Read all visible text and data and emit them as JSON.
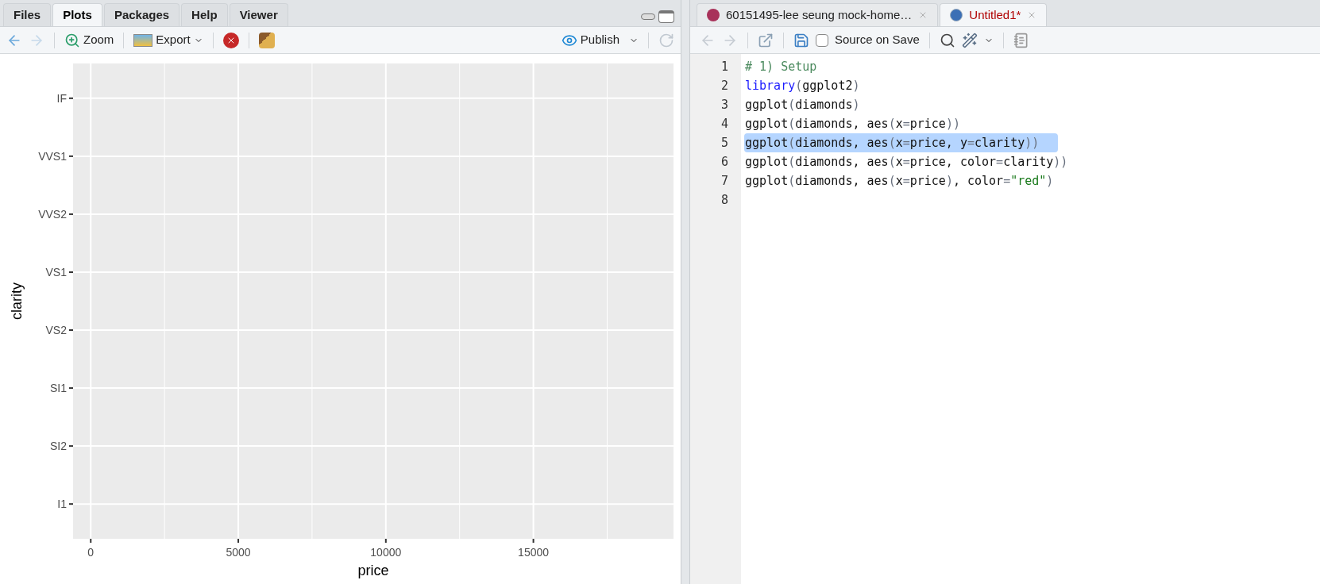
{
  "plots_pane": {
    "tabs": [
      {
        "label": "Files",
        "selected": false
      },
      {
        "label": "Plots",
        "selected": true
      },
      {
        "label": "Packages",
        "selected": false
      },
      {
        "label": "Help",
        "selected": false
      },
      {
        "label": "Viewer",
        "selected": false
      }
    ],
    "toolbar": {
      "zoom": "Zoom",
      "export": "Export",
      "publish": "Publish"
    },
    "chart_data": {
      "type": "scatter",
      "xlabel": "price",
      "ylabel": "clarity",
      "xlim": [
        -599,
        19748
      ],
      "xticks": [
        {
          "value": 0,
          "label": "0"
        },
        {
          "value": 5000,
          "label": "5000"
        },
        {
          "value": 10000,
          "label": "10000"
        },
        {
          "value": 15000,
          "label": "15000"
        }
      ],
      "orientation": "horizontal",
      "categories": [
        "IF",
        "VVS1",
        "VVS2",
        "VS1",
        "VS2",
        "SI1",
        "SI2",
        "I1"
      ],
      "grid": true
    }
  },
  "editor_pane": {
    "tabs": [
      {
        "label": "60151495-lee seung mock-home…",
        "kind": "rmd",
        "selected": false,
        "modified": false
      },
      {
        "label": "Untitled1*",
        "kind": "r",
        "selected": true,
        "modified": true
      }
    ],
    "toolbar": {
      "source_on_save": {
        "label": "Source on Save",
        "checked": false
      }
    },
    "lines": [
      {
        "number": "1",
        "selected": false,
        "tokens": [
          {
            "kind": "comment",
            "text": "# 1) Setup"
          }
        ]
      },
      {
        "number": "2",
        "selected": false,
        "tokens": [
          {
            "kind": "keyword",
            "text": "library"
          },
          {
            "kind": "paren",
            "text": "("
          },
          {
            "kind": "plain",
            "text": "ggplot2"
          },
          {
            "kind": "paren",
            "text": ")"
          }
        ]
      },
      {
        "number": "3",
        "selected": false,
        "tokens": [
          {
            "kind": "plain",
            "text": "ggplot"
          },
          {
            "kind": "paren",
            "text": "("
          },
          {
            "kind": "plain",
            "text": "diamonds"
          },
          {
            "kind": "paren",
            "text": ")"
          }
        ]
      },
      {
        "number": "4",
        "selected": false,
        "tokens": [
          {
            "kind": "plain",
            "text": "ggplot"
          },
          {
            "kind": "paren",
            "text": "("
          },
          {
            "kind": "plain",
            "text": "diamonds, aes"
          },
          {
            "kind": "paren",
            "text": "("
          },
          {
            "kind": "plain",
            "text": "x"
          },
          {
            "kind": "paren",
            "text": "="
          },
          {
            "kind": "plain",
            "text": "price"
          },
          {
            "kind": "paren",
            "text": "))"
          }
        ]
      },
      {
        "number": "5",
        "selected": true,
        "tokens": [
          {
            "kind": "plain",
            "text": "ggplot"
          },
          {
            "kind": "paren",
            "text": "("
          },
          {
            "kind": "plain",
            "text": "diamonds, aes"
          },
          {
            "kind": "paren",
            "text": "("
          },
          {
            "kind": "plain",
            "text": "x"
          },
          {
            "kind": "paren",
            "text": "="
          },
          {
            "kind": "plain",
            "text": "price, y"
          },
          {
            "kind": "paren",
            "text": "="
          },
          {
            "kind": "plain",
            "text": "clarity"
          },
          {
            "kind": "paren",
            "text": "))"
          }
        ]
      },
      {
        "number": "6",
        "selected": false,
        "tokens": [
          {
            "kind": "plain",
            "text": "ggplot"
          },
          {
            "kind": "paren",
            "text": "("
          },
          {
            "kind": "plain",
            "text": "diamonds, aes"
          },
          {
            "kind": "paren",
            "text": "("
          },
          {
            "kind": "plain",
            "text": "x"
          },
          {
            "kind": "paren",
            "text": "="
          },
          {
            "kind": "plain",
            "text": "price, color"
          },
          {
            "kind": "paren",
            "text": "="
          },
          {
            "kind": "plain",
            "text": "clarity"
          },
          {
            "kind": "paren",
            "text": "))"
          }
        ]
      },
      {
        "number": "7",
        "selected": false,
        "tokens": [
          {
            "kind": "plain",
            "text": "ggplot"
          },
          {
            "kind": "paren",
            "text": "("
          },
          {
            "kind": "plain",
            "text": "diamonds, aes"
          },
          {
            "kind": "paren",
            "text": "("
          },
          {
            "kind": "plain",
            "text": "x"
          },
          {
            "kind": "paren",
            "text": "="
          },
          {
            "kind": "plain",
            "text": "price"
          },
          {
            "kind": "paren",
            "text": ")"
          },
          {
            "kind": "plain",
            "text": ", color"
          },
          {
            "kind": "paren",
            "text": "="
          },
          {
            "kind": "string",
            "text": "\"red\""
          },
          {
            "kind": "paren",
            "text": ")"
          }
        ]
      },
      {
        "number": "8",
        "selected": false
      }
    ]
  }
}
